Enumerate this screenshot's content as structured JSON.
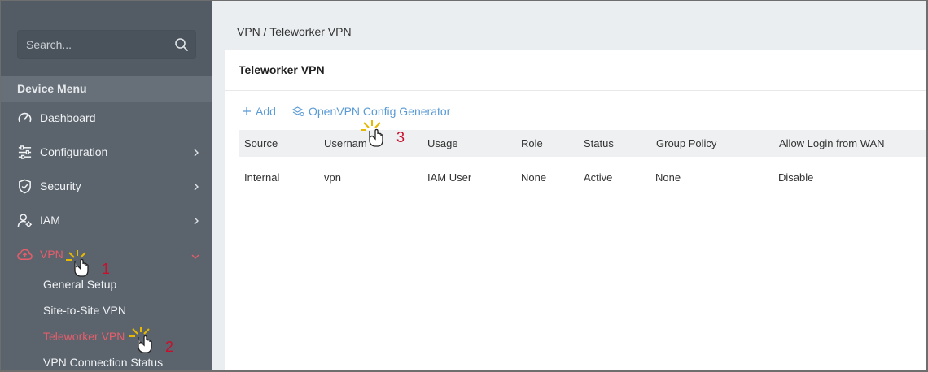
{
  "search": {
    "placeholder": "Search..."
  },
  "sidebar": {
    "section_title": "Device Menu",
    "items": [
      {
        "label": "Dashboard",
        "icon": "gauge-icon"
      },
      {
        "label": "Configuration",
        "icon": "sliders-icon"
      },
      {
        "label": "Security",
        "icon": "shield-icon"
      },
      {
        "label": "IAM",
        "icon": "user-gear-icon"
      },
      {
        "label": "VPN",
        "icon": "cloud-upload-icon",
        "active": true
      }
    ],
    "vpn_sub": [
      {
        "label": "General Setup"
      },
      {
        "label": "Site-to-Site VPN"
      },
      {
        "label": "Teleworker VPN",
        "active": true
      },
      {
        "label": "VPN Connection Status"
      }
    ]
  },
  "breadcrumb": "VPN / Teleworker VPN",
  "panel": {
    "title": "Teleworker VPN",
    "add_label": "Add",
    "generator_label": "OpenVPN Config Generator"
  },
  "table": {
    "headers": [
      "Source",
      "Usernam",
      "Usage",
      "Role",
      "Status",
      "Group Policy",
      "Allow Login from WAN"
    ],
    "rows": [
      [
        "Internal",
        "vpn",
        "IAM User",
        "None",
        "Active",
        "None",
        "Disable"
      ]
    ]
  },
  "annotations": {
    "step1": "1",
    "step2": "2",
    "step3": "3"
  },
  "colors": {
    "accent_red": "#e85d6a",
    "link_blue": "#5b9bd5",
    "sidebar_bg": "#5b646d"
  }
}
